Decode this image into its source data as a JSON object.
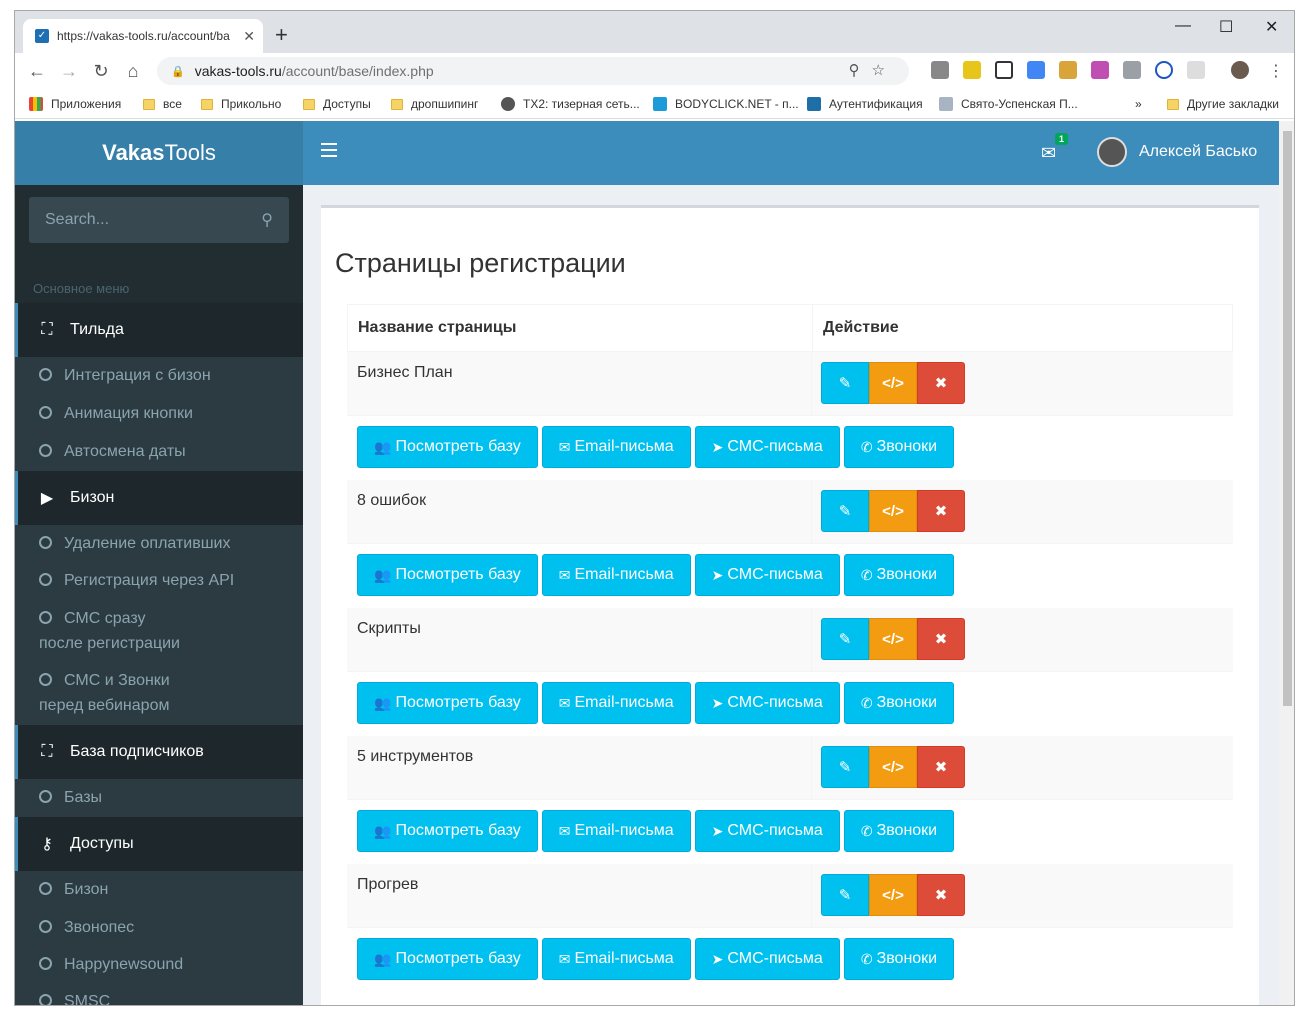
{
  "browser": {
    "tab_title": "https://vakas-tools.ru/account/ba",
    "url_host": "vakas-tools.ru",
    "url_path": "/account/base/index.php",
    "bookmarks": [
      "Приложения",
      "все",
      "Прикольно",
      "Доступы",
      "дропшипинг",
      "TX2: тизерная сеть...",
      "BODYCLICK.NET - п...",
      "Аутентификация",
      "Свято-Успенская П...",
      "Другие закладки"
    ]
  },
  "header": {
    "logo_bold": "Vakas",
    "logo_rest": "Tools",
    "mail_count": "1",
    "user_name": "Алексей Басько"
  },
  "sidebar": {
    "search_placeholder": "Search...",
    "menu_heading": "Основное меню",
    "sections": [
      {
        "label": "Тильда",
        "items": [
          "Интеграция с бизон",
          "Анимация кнопки",
          "Автосмена даты"
        ]
      },
      {
        "label": "Бизон",
        "items": [
          "Удаление оплативших",
          "Регистрация через API",
          "СМС сразу",
          "после регистрации",
          "СМС и Звонки",
          "перед вебинаром"
        ]
      },
      {
        "label": "База подписчиков",
        "items": [
          "Базы"
        ]
      },
      {
        "label": "Доступы",
        "items": [
          "Бизон",
          "Звонопес",
          "Happynewsound",
          "SMSC"
        ]
      }
    ]
  },
  "main": {
    "title": "Страницы регистрации",
    "col_name": "Название страницы",
    "col_action": "Действие",
    "rows": [
      "Бизнес План",
      "8 ошибок",
      "Скрипты",
      "5 инструментов",
      "Прогрев"
    ],
    "buttons": {
      "view_base": "Посмотреть базу",
      "email": "Email-письма",
      "sms": "СМС-письма",
      "calls": "Звоноки"
    }
  }
}
